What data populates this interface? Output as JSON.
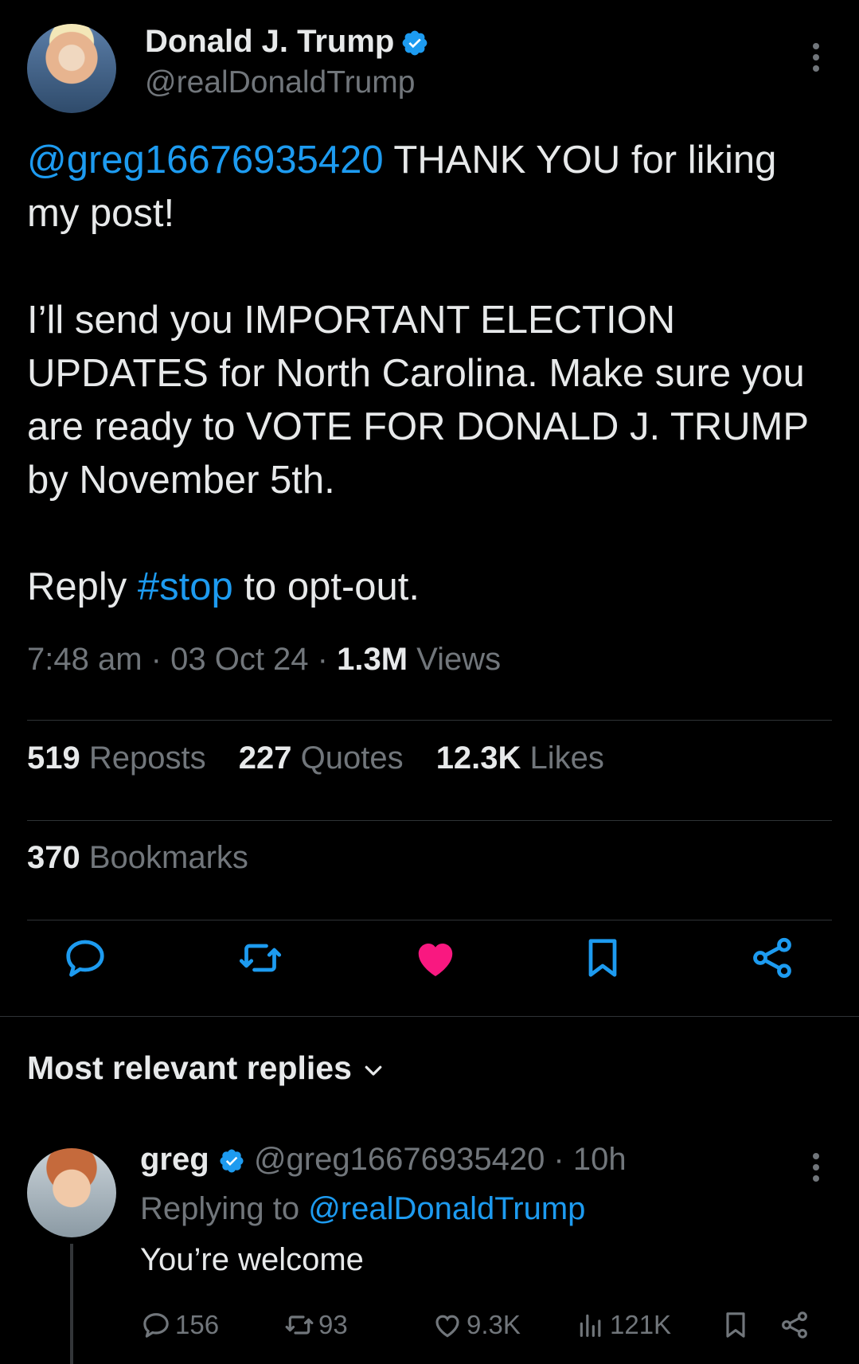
{
  "post": {
    "author_name": "Donald J. Trump",
    "author_handle": "@realDonaldTrump",
    "mention": "@greg16676935420",
    "line1_rest": " THANK YOU for liking my post!",
    "para2": "I’ll send you IMPORTANT ELECTION UPDATES for North Carolina. Make sure you are ready to VOTE FOR DONALD J. TRUMP by November 5th.",
    "para3_pre": "Reply ",
    "hashtag": "#stop",
    "para3_post": " to opt-out.",
    "time": "7:48 am",
    "sep": "·",
    "date": "03 Oct 24",
    "views_count": "1.3M",
    "views_label": " Views",
    "reposts_count": "519",
    "reposts_label": " Reposts",
    "quotes_count": "227",
    "quotes_label": " Quotes",
    "likes_count": "12.3K",
    "likes_label": " Likes",
    "bookmarks_count": "370",
    "bookmarks_label": " Bookmarks",
    "liked": true
  },
  "colors": {
    "accent": "#1d9bf0",
    "like": "#f91880",
    "muted": "#71767b",
    "background": "#000000"
  },
  "replies_header": "Most relevant replies",
  "reply": {
    "name": "greg",
    "handle": "@greg16676935420",
    "sep": " · ",
    "age": "10h",
    "replying_prefix": "Replying to ",
    "replying_handle": "@realDonaldTrump",
    "text": "You’re welcome",
    "replies": "156",
    "reposts": "93",
    "likes": "9.3K",
    "views": "121K"
  }
}
